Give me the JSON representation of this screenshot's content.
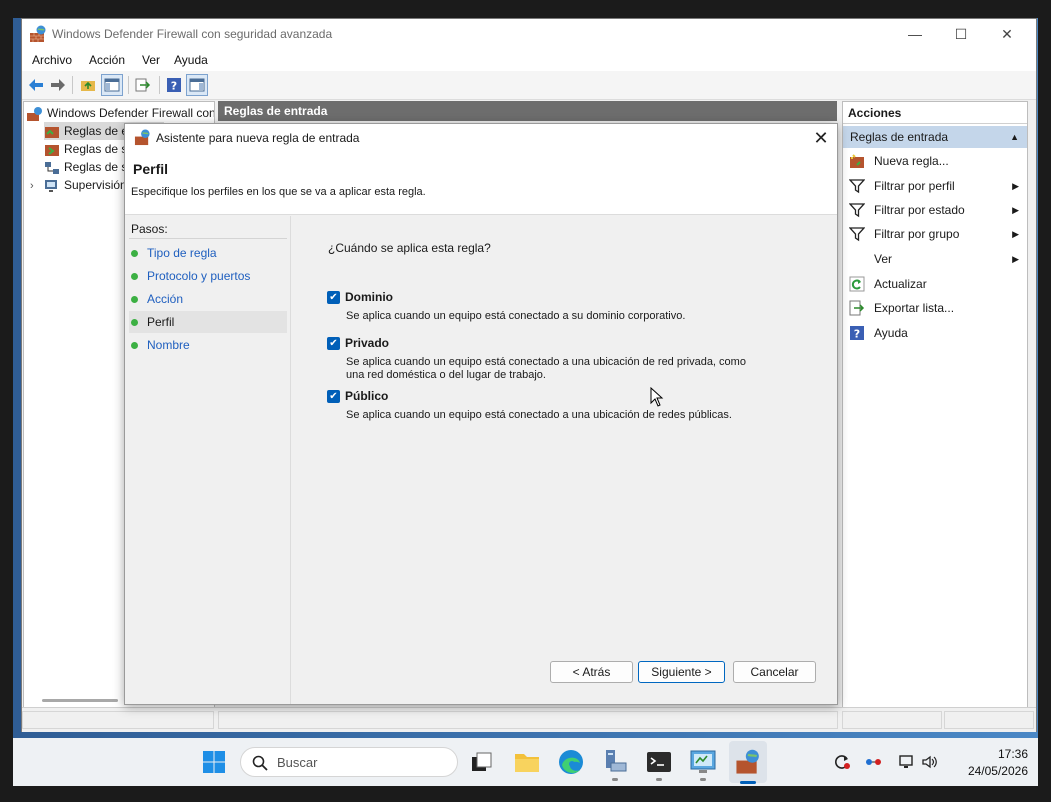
{
  "window": {
    "title": "Windows Defender Firewall con seguridad avanzada",
    "minimize": "—",
    "maximize": "☐",
    "close": "✕"
  },
  "menu": [
    "Archivo",
    "Acción",
    "Ver",
    "Ayuda"
  ],
  "tree": {
    "root": "Windows Defender Firewall con",
    "items": [
      "Reglas de e",
      "Reglas de s",
      "Reglas de s",
      "Supervisión"
    ]
  },
  "center": {
    "header": "Reglas de entrada"
  },
  "actions": {
    "title": "Acciones",
    "section": "Reglas de entrada",
    "items": [
      {
        "label": "Nueva regla...",
        "icon": "new-rule-icon",
        "submenu": false
      },
      {
        "label": "Filtrar por perfil",
        "icon": "filter-icon",
        "submenu": true
      },
      {
        "label": "Filtrar por estado",
        "icon": "filter-icon",
        "submenu": true
      },
      {
        "label": "Filtrar por grupo",
        "icon": "filter-icon",
        "submenu": true
      },
      {
        "label": "Ver",
        "icon": "",
        "submenu": true
      },
      {
        "label": "Actualizar",
        "icon": "refresh-icon",
        "submenu": false
      },
      {
        "label": "Exportar lista...",
        "icon": "export-icon",
        "submenu": false
      },
      {
        "label": "Ayuda",
        "icon": "help-icon",
        "submenu": false
      }
    ]
  },
  "wizard": {
    "title": "Asistente para nueva regla de entrada",
    "heading": "Perfil",
    "description": "Especifique los perfiles en los que se va a aplicar esta regla.",
    "steps_label": "Pasos:",
    "steps": [
      "Tipo de regla",
      "Protocolo y puertos",
      "Acción",
      "Perfil",
      "Nombre"
    ],
    "current_step": "Perfil",
    "question": "¿Cuándo se aplica esta regla?",
    "options": [
      {
        "title": "Dominio",
        "checked": true,
        "desc": "Se aplica cuando un equipo está conectado a su dominio corporativo."
      },
      {
        "title": "Privado",
        "checked": true,
        "desc": "Se aplica cuando un equipo está conectado a una ubicación de red privada, como una red doméstica o del lugar de trabajo."
      },
      {
        "title": "Público",
        "checked": true,
        "desc": "Se aplica cuando un equipo está conectado a una ubicación de redes públicas."
      }
    ],
    "buttons": {
      "back": "< Atrás",
      "next": "Siguiente >",
      "cancel": "Cancelar"
    }
  },
  "taskbar": {
    "search_placeholder": "Buscar",
    "time": "17:36",
    "date": "24/05/2026"
  },
  "colors": {
    "accent": "#005fb8",
    "step_dot": "#3cb043",
    "step_link": "#1f5fbf",
    "actions_section": "#c4d6ea",
    "center_header": "#6d6d6d"
  }
}
